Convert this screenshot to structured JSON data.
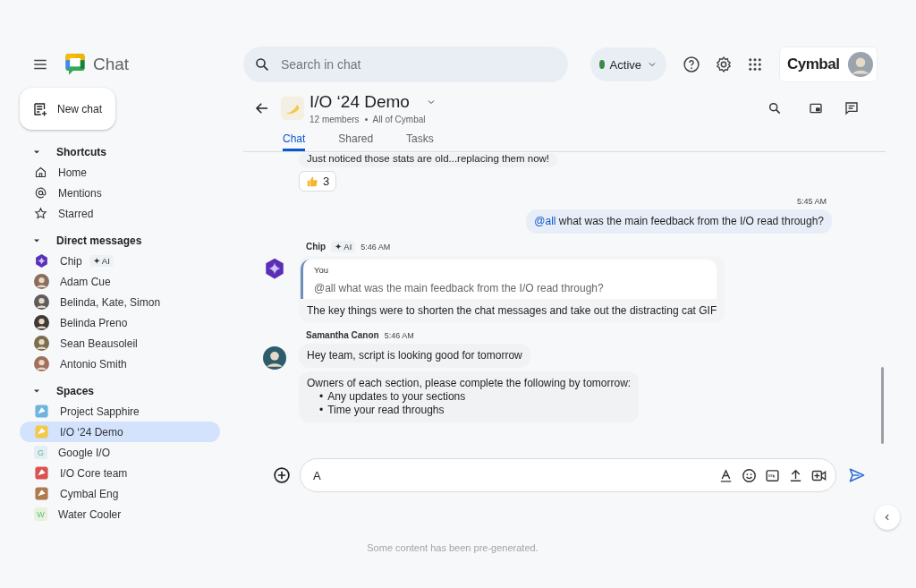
{
  "app": {
    "name": "Chat"
  },
  "new_chat": {
    "label": "New chat"
  },
  "search": {
    "placeholder": "Search in chat"
  },
  "status": {
    "label": "Active",
    "on": true
  },
  "brand": {
    "name": "Cymbal"
  },
  "sidebar": {
    "sections": [
      {
        "title": "Shortcuts",
        "expanded": true,
        "items": [
          {
            "label": "Home",
            "kind": "home",
            "selected": false
          },
          {
            "label": "Mentions",
            "kind": "mention",
            "selected": false
          },
          {
            "label": "Starred",
            "kind": "star",
            "selected": false
          }
        ]
      },
      {
        "title": "Direct messages",
        "expanded": true,
        "items": [
          {
            "label": "Chip",
            "kind": "ai",
            "badge": "✦ AI",
            "selected": false
          },
          {
            "label": "Adam Cue",
            "kind": "person",
            "color": "#8a6d5a",
            "selected": false
          },
          {
            "label": "Belinda, Kate, Simon",
            "kind": "person",
            "color": "#5d5d5d",
            "selected": false
          },
          {
            "label": "Belinda Preno",
            "kind": "person",
            "color": "#3e3a36",
            "selected": false
          },
          {
            "label": "Sean Beausoleil",
            "kind": "person",
            "color": "#7b6e4e",
            "selected": false
          },
          {
            "label": "Antonio Smith",
            "kind": "person",
            "color": "#a0705a",
            "selected": false
          }
        ]
      },
      {
        "title": "Spaces",
        "expanded": true,
        "items": [
          {
            "label": "Project Sapphire",
            "kind": "space",
            "color": "#6fb3e0",
            "selected": false
          },
          {
            "label": "I/O ‘24 Demo",
            "kind": "space",
            "color": "#f2c94c",
            "selected": true
          },
          {
            "label": "Google I/O",
            "kind": "letter",
            "initial": "G",
            "color": "#e3edf5",
            "selected": false
          },
          {
            "label": "I/O Core team",
            "kind": "space",
            "color": "#d9534f",
            "selected": false
          },
          {
            "label": "Cymbal Eng",
            "kind": "space",
            "color": "#b07a4a",
            "selected": false
          },
          {
            "label": "Water Cooler",
            "kind": "letter",
            "initial": "W",
            "color": "#e6f2dc",
            "selected": false
          }
        ]
      }
    ]
  },
  "chat": {
    "title": "I/O ‘24 Demo",
    "members": "12 members",
    "audience": "All of Cymbal",
    "tabs": [
      {
        "label": "Chat",
        "selected": true
      },
      {
        "label": "Shared",
        "selected": false
      },
      {
        "label": "Tasks",
        "selected": false
      }
    ],
    "messages": [
      {
        "kind": "continued",
        "text": "Just noticed those stats are old...replacing them now!",
        "reaction": {
          "count": "3"
        }
      },
      {
        "kind": "outgoing",
        "time": "5:45 AM",
        "mention": "@all",
        "text": "what was the main feedback from the I/O read through?"
      },
      {
        "kind": "incoming",
        "sender": "Chip",
        "badge": "✦ AI",
        "time": "5:46 AM",
        "avatar": {
          "kind": "ai"
        },
        "bubbles": [
          {
            "kind": "quote",
            "author": "You",
            "quote": "@all what was the main feedback from the I/O read through?",
            "text": "The key things were to shorten the chat messages and take out the distracting cat GIF"
          }
        ]
      },
      {
        "kind": "incoming",
        "sender": "Samantha Canon",
        "time": "5:46 AM",
        "avatar": {
          "kind": "person"
        },
        "bubbles": [
          {
            "kind": "text",
            "text": "Hey team, script is looking good for tomorrow"
          },
          {
            "kind": "list",
            "text": "Owners of each section, please complete the following by tomorrow:",
            "items": [
              {
                "bullet": "•",
                "text": "Any updates to your sections"
              },
              {
                "bullet": "•",
                "text": "Time your read throughs"
              }
            ]
          }
        ]
      }
    ],
    "composer": {
      "value": "A"
    }
  },
  "footer": {
    "note": "Some content has been pre-generated."
  }
}
